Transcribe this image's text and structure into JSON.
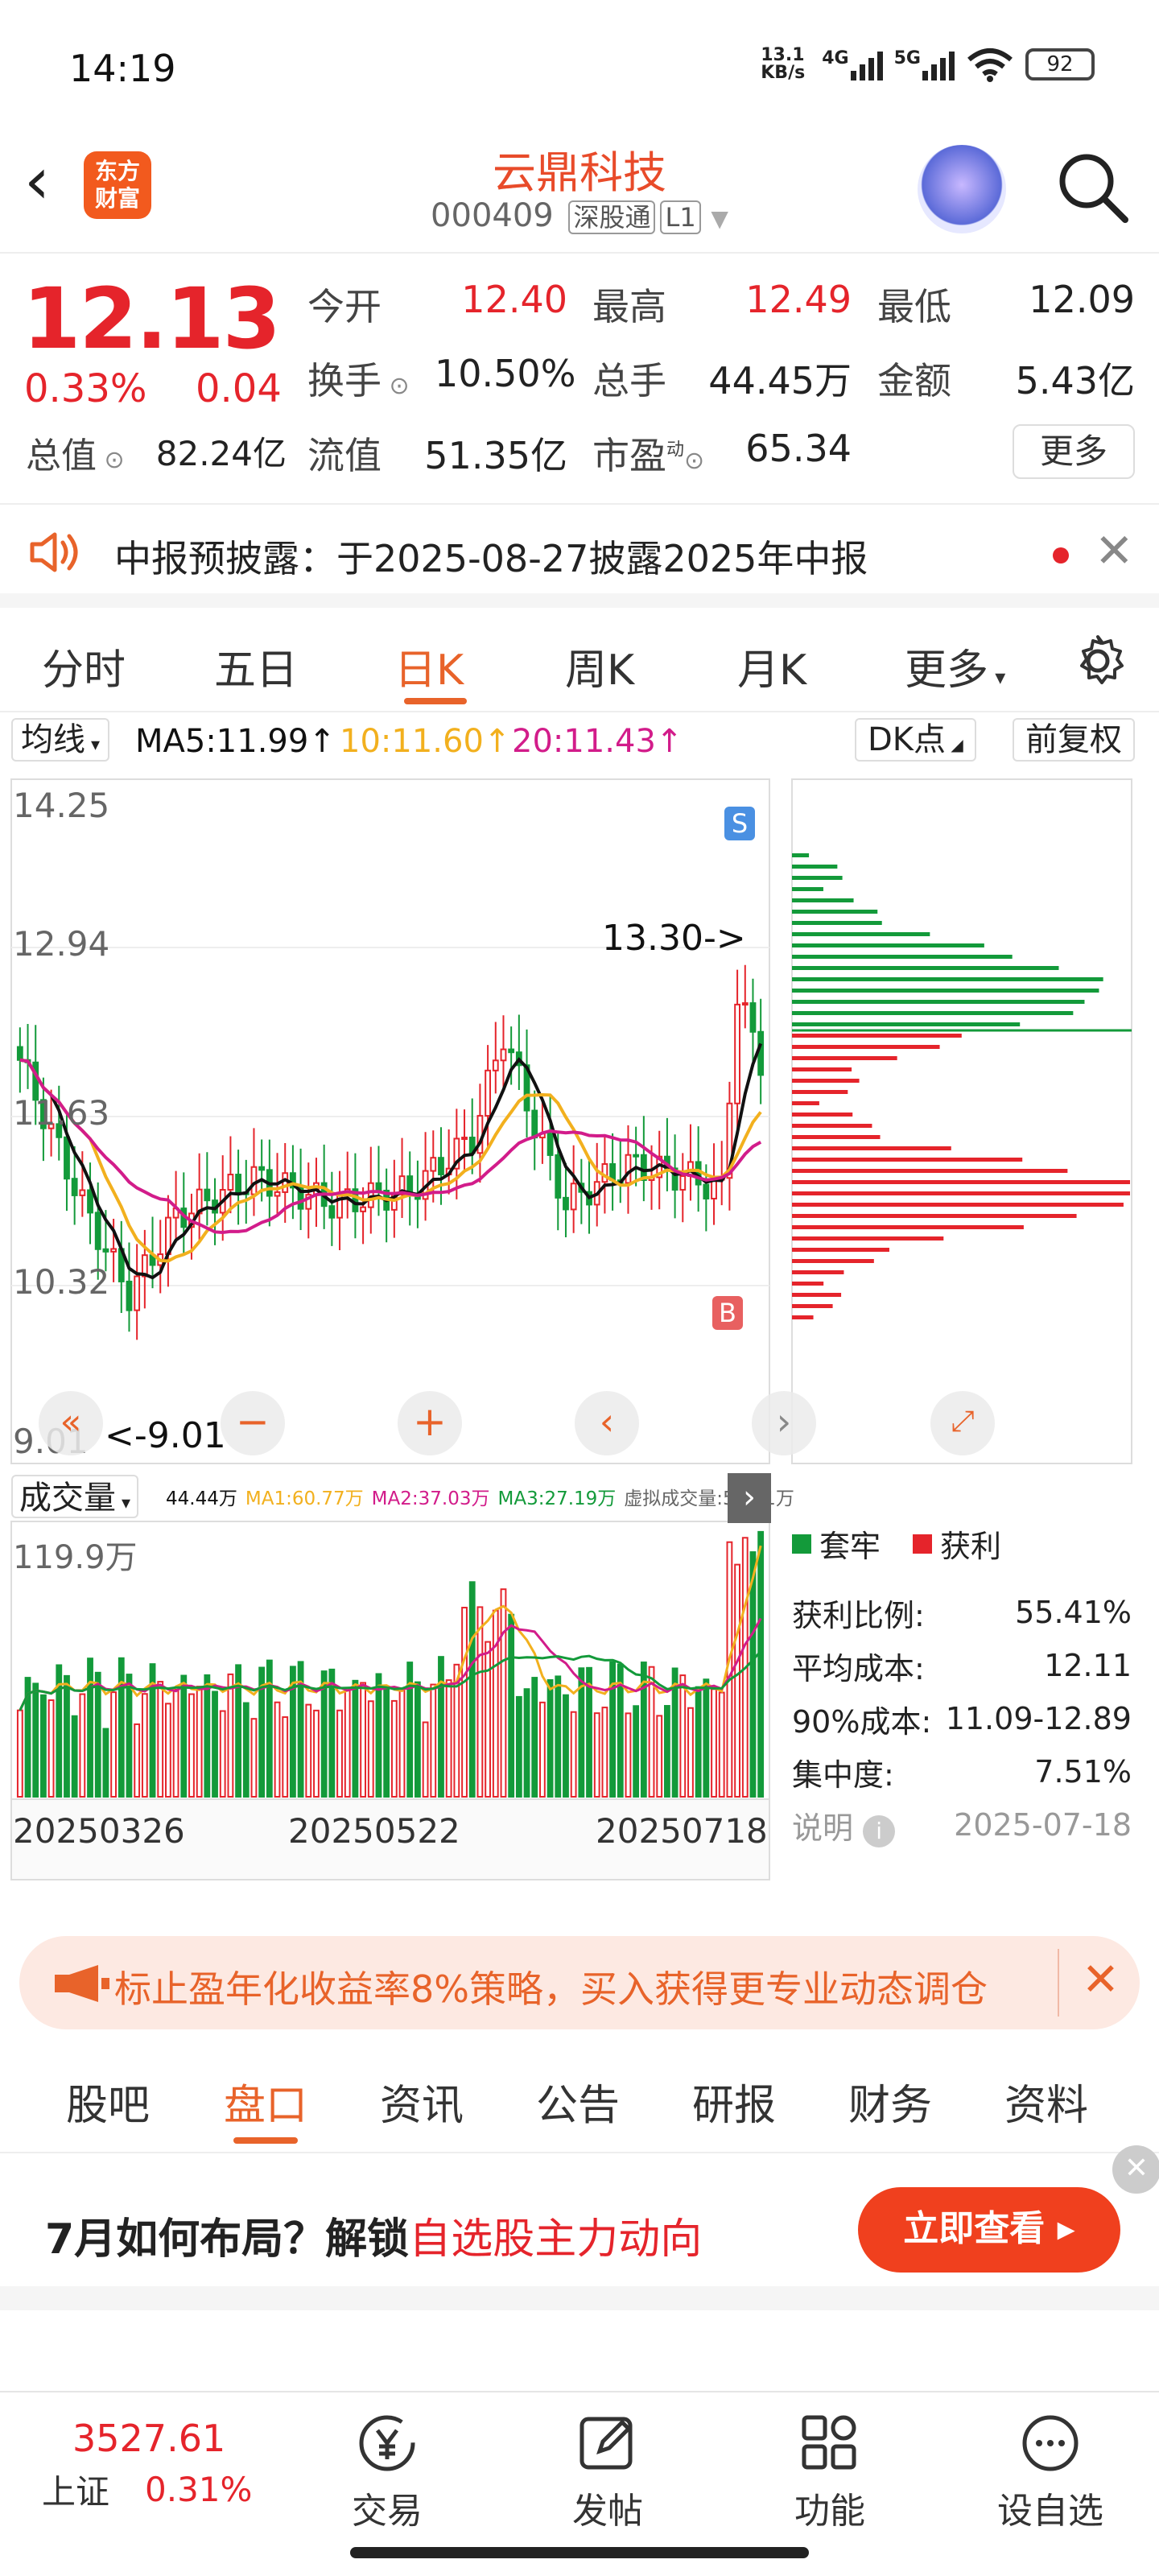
{
  "status_bar": {
    "time": "14:19",
    "speed": "13.1\nKB/s",
    "net1": "4G",
    "net2": "5G",
    "battery": "92"
  },
  "header": {
    "logo_text": "东方\n财富",
    "title": "云鼎科技",
    "code": "000409",
    "tag1": "深股通",
    "tag2": "L1"
  },
  "quote": {
    "price": "12.13",
    "change_pct": "0.33%",
    "change": "0.04",
    "open_label": "今开",
    "open": "12.40",
    "high_label": "最高",
    "high": "12.49",
    "low_label": "最低",
    "low": "12.09",
    "turnover_label": "换手",
    "turnover": "10.50%",
    "volume_label": "总手",
    "volume": "44.45万",
    "amount_label": "金额",
    "amount": "5.43亿",
    "mcap_label": "总值",
    "mcap": "82.24亿",
    "float_label": "流值",
    "float": "51.35亿",
    "pe_label": "市盈",
    "pe_sup": "动",
    "pe": "65.34",
    "more": "更多"
  },
  "notice": {
    "text": "中报预披露：于2025-08-27披露2025年中报"
  },
  "kline_tabs": [
    "分时",
    "五日",
    "日K",
    "周K",
    "月K",
    "更多"
  ],
  "kline_active": "日K",
  "indicator_bar": {
    "selector": "均线",
    "ma5": "MA5:11.99",
    "ma10": "10:11.60",
    "ma20": "20:11.43",
    "dk": "DK点",
    "adjust": "前复权"
  },
  "price_chart": {
    "y_labels": [
      "14.25",
      "12.94",
      "11.63",
      "10.32",
      "9.01"
    ],
    "high_marker": "13.30->",
    "low_marker": "<-9.01",
    "s_badge": "S",
    "b_badge": "B",
    "colors": {
      "up": "#e5242b",
      "down": "#139a3a",
      "ma5": "#111111",
      "ma10": "#f2b01e",
      "ma20": "#d21c8a"
    }
  },
  "volume_bar": {
    "label": "成交量",
    "vol": "44.44万",
    "ma1": "MA1:60.77万",
    "ma2": "MA2:37.03万",
    "ma3": "MA3:27.19万",
    "virtual": "虚拟成交量:52.01万",
    "max": "119.9万"
  },
  "dates": [
    "20250326",
    "20250522",
    "20250718"
  ],
  "chips": {
    "legend_locked": "套牢",
    "legend_profit": "获利",
    "rows": [
      {
        "label": "获利比例:",
        "value": "55.41%"
      },
      {
        "label": "平均成本:",
        "value": "12.11"
      },
      {
        "label": "90%成本:",
        "value": "11.09-12.89"
      },
      {
        "label": "集中度:",
        "value": "7.51%"
      }
    ],
    "note": "说明",
    "date": "2025-07-18"
  },
  "banner": {
    "text": "标止盈年化收益率8%策略，买入获得更专业动态调仓"
  },
  "section_tabs": [
    "股吧",
    "盘口",
    "资讯",
    "公告",
    "研报",
    "财务",
    "资料"
  ],
  "section_active": "盘口",
  "ad": {
    "part1": "7月如何布局？解锁",
    "part2": "自选股主力动向",
    "button": "立即查看 ▸"
  },
  "bottom_nav": {
    "index_value": "3527.61",
    "index_name": "上证",
    "index_change": "0.31%",
    "items": [
      "交易",
      "发帖",
      "功能",
      "设自选"
    ]
  }
}
